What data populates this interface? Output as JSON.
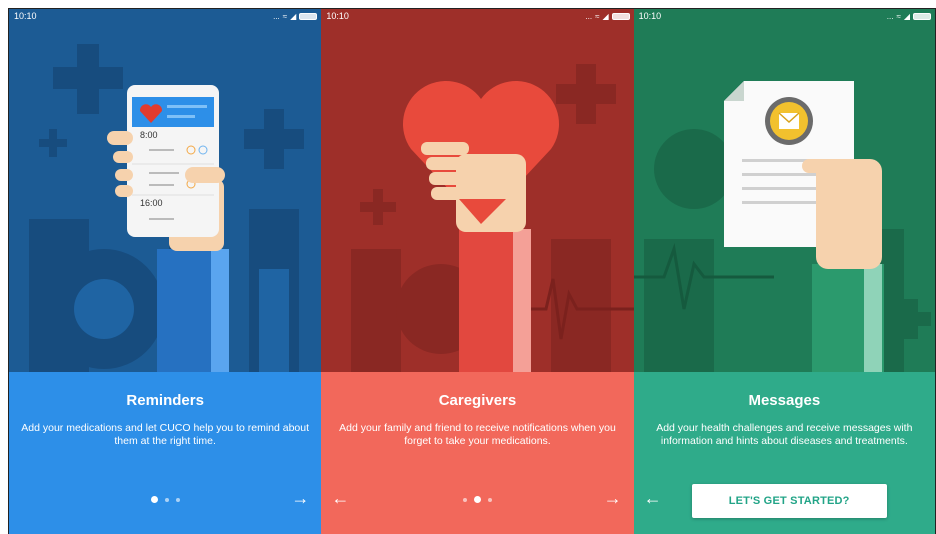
{
  "status_bar": {
    "time": "10:10",
    "dots": "...",
    "signal": "◢"
  },
  "colors": {
    "reminders_top": "#1c5b94",
    "reminders_bottom": "#2d8fe8",
    "caregivers_top": "#9e2f29",
    "caregivers_bottom": "#f2685b",
    "messages_top": "#1f7c57",
    "messages_bottom": "#2fab8a"
  },
  "screens": [
    {
      "title": "Reminders",
      "description": "Add your medications and let CUCO help you to remind about them at the right time.",
      "phone_times": [
        "8:00",
        "16:00"
      ],
      "next_icon": "arrow-right-icon"
    },
    {
      "title": "Caregivers",
      "description": "Add your family and friend to receive notifications when you forget to take your medications.",
      "prev_icon": "arrow-left-icon",
      "next_icon": "arrow-right-icon"
    },
    {
      "title": "Messages",
      "description": "Add your health challenges and receive messages with information and hints about diseases and treatments.",
      "prev_icon": "arrow-left-icon",
      "cta_label": "LET'S GET STARTED?"
    }
  ],
  "pager": {
    "count": 3
  },
  "arrows": {
    "right": "→",
    "left": "←"
  }
}
